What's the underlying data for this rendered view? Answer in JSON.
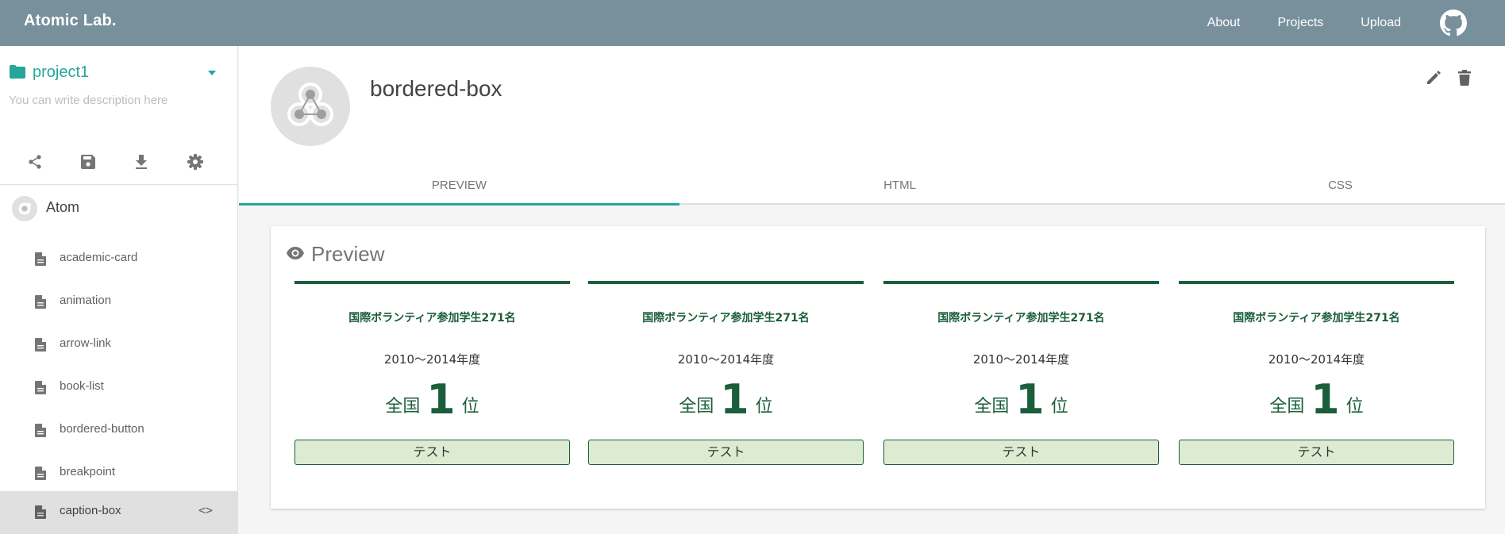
{
  "topbar": {
    "brand": "Atomic Lab.",
    "links": [
      "About",
      "Projects",
      "Upload"
    ],
    "github_icon": "github-icon"
  },
  "sidebar": {
    "project_name": "project1",
    "project_description": "You can write description here",
    "tools": [
      "share-icon",
      "save-icon",
      "download-icon",
      "gear-icon"
    ],
    "section_label": "Atom",
    "items": [
      {
        "label": "academic-card"
      },
      {
        "label": "animation"
      },
      {
        "label": "arrow-link"
      },
      {
        "label": "book-list"
      },
      {
        "label": "bordered-button"
      },
      {
        "label": "breakpoint"
      },
      {
        "label": "caption-box",
        "active": true,
        "code_icon": "<>"
      }
    ]
  },
  "component": {
    "title": "bordered-box",
    "tabs": [
      "PREVIEW",
      "HTML",
      "CSS"
    ],
    "active_tab": "PREVIEW"
  },
  "preview": {
    "title": "Preview",
    "boxes": [
      {
        "heading": "国際ボランティア参加学生271名",
        "period": "2010〜2014年度",
        "rank_prefix": "全国",
        "rank_number": "1",
        "rank_suffix": "位",
        "button": "テスト"
      },
      {
        "heading": "国際ボランティア参加学生271名",
        "period": "2010〜2014年度",
        "rank_prefix": "全国",
        "rank_number": "1",
        "rank_suffix": "位",
        "button": "テスト"
      },
      {
        "heading": "国際ボランティア参加学生271名",
        "period": "2010〜2014年度",
        "rank_prefix": "全国",
        "rank_number": "1",
        "rank_suffix": "位",
        "button": "テスト"
      },
      {
        "heading": "国際ボランティア参加学生271名",
        "period": "2010〜2014年度",
        "rank_prefix": "全国",
        "rank_number": "1",
        "rank_suffix": "位",
        "button": "テスト"
      }
    ]
  },
  "colors": {
    "topbar": "#78909c",
    "accent": "#26a69a",
    "box_green": "#1b5e3a",
    "button_bg": "#dcebd2"
  }
}
